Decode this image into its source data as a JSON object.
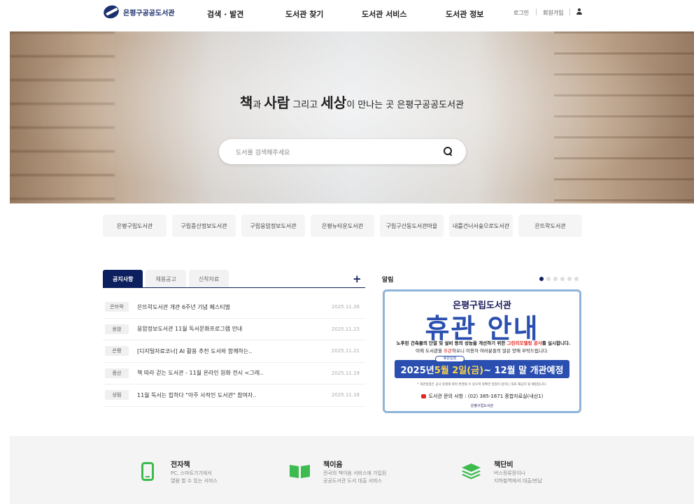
{
  "header": {
    "logo_text": "은평구공공도서관",
    "nav": [
      "검색 · 발견",
      "도서관 찾기",
      "도서관 서비스",
      "도서관 정보"
    ],
    "login": "로그인",
    "signup": "회원가입"
  },
  "hero": {
    "w1": "책",
    "c1": "과 ",
    "w2": "사람",
    "c2": " 그리고 ",
    "w3": "세상",
    "c3": "이 만나는 곳 은평구공공도서관",
    "search_placeholder": "도서를 검색해주세요"
  },
  "branches": [
    "은평구립도서관",
    "구립증산정보도서관",
    "구립응암정보도서관",
    "은평뉴타운도서관",
    "구립구산동도서관마을",
    "내를건너서숲으로도서관",
    "은뜨락도서관"
  ],
  "notices": {
    "tabs": [
      "공지사항",
      "채용공고",
      "신착자료"
    ],
    "more": "+",
    "items": [
      {
        "tag": "은뜨락",
        "title": "은뜨락도서관 개관 6주년 기념 페스티벌",
        "date": "2025.11.26"
      },
      {
        "tag": "응암",
        "title": "응암정보도서관 11월 독서문화프로그램 안내",
        "date": "2025.11.23"
      },
      {
        "tag": "은평",
        "title": "[디지털자료코너] AI 활용 추천 도서와 함께하는..",
        "date": "2025.11.21"
      },
      {
        "tag": "증산",
        "title": "책 따라 걷는 도서관 - 11월 온라인 원화 전시 <그레..",
        "date": "2025.11.19"
      },
      {
        "tag": "상림",
        "title": "11월 독서는 힙하다 \"아주 사적인 도서관\" 참여자..",
        "date": "2025.11.18"
      }
    ]
  },
  "alert": {
    "label": "알림",
    "banner": {
      "library": "은평구립도서관",
      "headline": "휴관 안내",
      "line1_a": "노후된 건축물의 단열 및 설비 등의 성능을 개선하기 위한 ",
      "line1_red": "그린리모델링 공사",
      "line1_b": "를 실시합니다.",
      "line2_a": "이에 도서관을 ",
      "line2_red": "휴관",
      "line2_b": "하오니 이용자 여러분들의 많은 양해 부탁드립니다.",
      "schedule_tag": "휴관일정",
      "sched_a": "2025년 ",
      "sched_hl": "5월 2일(금)",
      "sched_b": " ~ 12월 말 개관예정",
      "note": "* 개관일정은 공사 일정에 따라 변경될 수 있으며 정확한 일정이 잡히는 대로 재공지 될 예정입니다.",
      "phone": "도서관 문의 사항 : (02) 385-1671 종합자료실(내선1)",
      "footer": "은평구립도서관"
    }
  },
  "services": [
    {
      "icon": "phone-icon",
      "title": "전자책",
      "desc1": "PC, 스마트기기에서",
      "desc2": "열람 할 수 있는 서비스"
    },
    {
      "icon": "book-icon",
      "title": "책이음",
      "desc1": "전국의 책이음 서비스에 가입된",
      "desc2": "공공도서관 도서 대출 서비스"
    },
    {
      "icon": "layers-icon",
      "title": "책단비",
      "desc1": "버스정류장이나",
      "desc2": "지하철역에서 대출/반납"
    }
  ],
  "colors": {
    "navy": "#0c1f5e",
    "green": "#3dbb4f",
    "banner_blue": "#2a4fb0",
    "red": "#e0261e"
  }
}
